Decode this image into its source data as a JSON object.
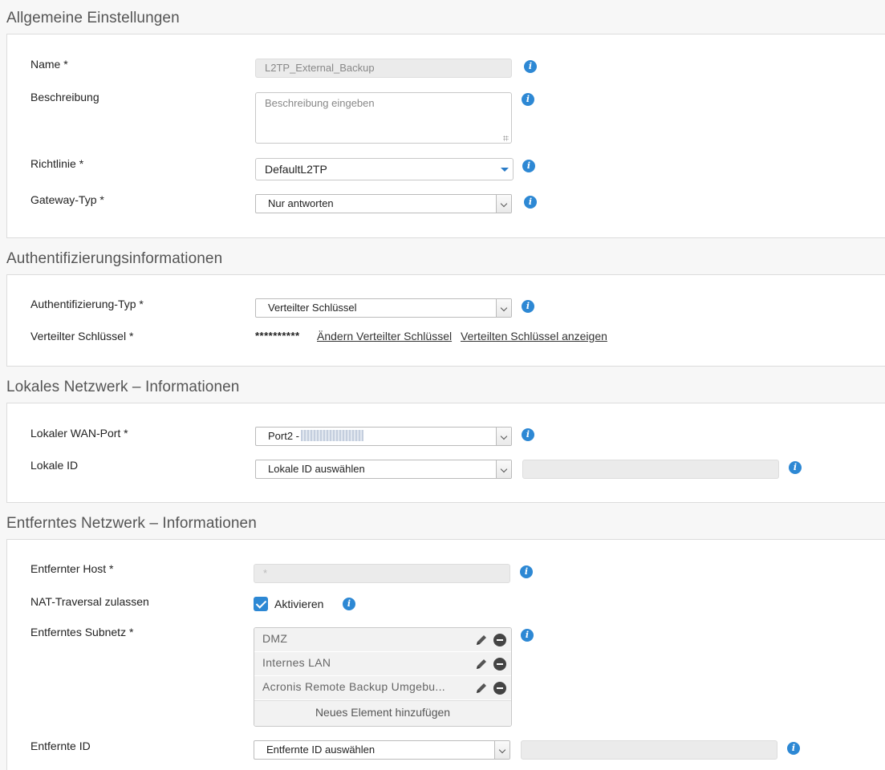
{
  "sections": {
    "general": "Allgemeine Einstellungen",
    "auth": "Authentifizierungsinformationen",
    "local": "Lokales Netzwerk – Informationen",
    "remote": "Entferntes Netzwerk – Informationen"
  },
  "general": {
    "name_label": "Name *",
    "name_value": "L2TP_External_Backup",
    "description_label": "Beschreibung",
    "description_placeholder": "Beschreibung eingeben",
    "policy_label": "Richtlinie *",
    "policy_value": "DefaultL2TP",
    "gateway_type_label": "Gateway-Typ *",
    "gateway_type_value": "Nur antworten"
  },
  "auth": {
    "type_label": "Authentifizierung-Typ *",
    "type_value": "Verteilter Schlüssel",
    "key_label": "Verteilter Schlüssel *",
    "key_masked": "**********",
    "change_key_link": "Ändern Verteilter Schlüssel",
    "show_key_link": "Verteilten Schlüssel anzeigen"
  },
  "local": {
    "wan_port_label": "Lokaler WAN-Port *",
    "wan_port_value": "Port2 -",
    "local_id_label": "Lokale ID",
    "local_id_value": "Lokale ID auswählen"
  },
  "remote": {
    "host_label": "Entfernter Host *",
    "host_value": "*",
    "nat_label": "NAT-Traversal zulassen",
    "nat_checkbox_label": "Aktivieren",
    "nat_checked": true,
    "subnet_label": "Entferntes Subnetz *",
    "subnets": [
      "DMZ",
      "Internes LAN",
      "Acronis Remote Backup Umgebu..."
    ],
    "add_item": "Neues Element hinzufügen",
    "remote_id_label": "Entfernte ID",
    "remote_id_value": "Entfernte ID auswählen"
  },
  "icons": {
    "info": "info-icon",
    "edit": "pencil-icon",
    "remove": "minus-circle-icon",
    "check": "checkmark-icon"
  },
  "colors": {
    "accent": "#2d88d4"
  }
}
